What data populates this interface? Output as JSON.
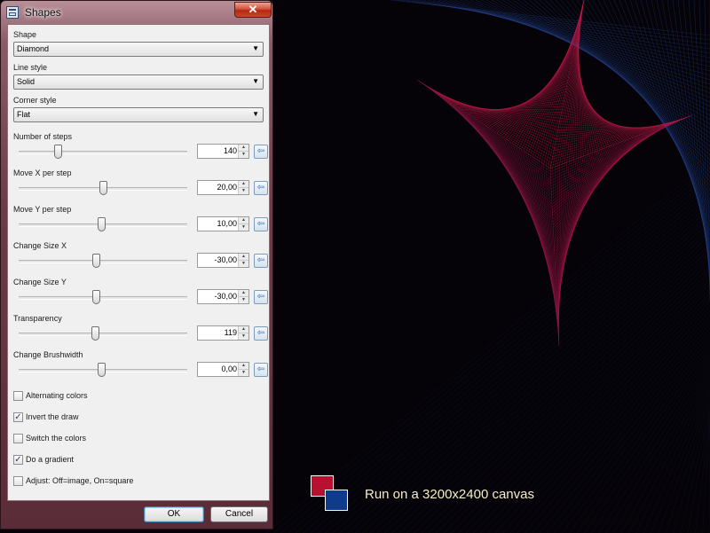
{
  "window": {
    "title": "Shapes",
    "close_label": "✕",
    "ok_label": "OK",
    "cancel_label": "Cancel"
  },
  "dropdowns": [
    {
      "label": "Shape",
      "value": "Diamond"
    },
    {
      "label": "Line style",
      "value": "Solid"
    },
    {
      "label": "Corner style",
      "value": "Flat"
    }
  ],
  "sliders": [
    {
      "label": "Number of steps",
      "value": "140",
      "position": 0.23
    },
    {
      "label": "Move X per step",
      "value": "20,00",
      "position": 0.5
    },
    {
      "label": "Move Y per step",
      "value": "10,00",
      "position": 0.49
    },
    {
      "label": "Change Size X",
      "value": "-30,00",
      "position": 0.46
    },
    {
      "label": "Change Size Y",
      "value": "-30,00",
      "position": 0.46
    },
    {
      "label": "Transparency",
      "value": "119",
      "position": 0.45
    },
    {
      "label": "Change Brushwidth",
      "value": "0,00",
      "position": 0.49
    }
  ],
  "checkboxes": [
    {
      "label": "Alternating colors",
      "checked": false
    },
    {
      "label": "Invert the draw",
      "checked": true
    },
    {
      "label": "Switch the colors",
      "checked": false
    },
    {
      "label": "Do a gradient",
      "checked": true
    },
    {
      "label": "Adjust: Off=image, On=square",
      "checked": false
    }
  ],
  "icons": {
    "app": "shapes-app-icon",
    "reset": "arrow-left-icon",
    "spin_up": "▲",
    "spin_down": "▼",
    "dropdown_arrow": "▼",
    "check_mark": "✓"
  },
  "legend": {
    "primary_color": "#b7112f",
    "secondary_color": "#0e3b8b",
    "caption": "Run on a 3200x2400 canvas"
  },
  "canvas": {
    "background_color": "#050307",
    "primary_line_color": "#b7112f",
    "secondary_line_color": "#0e3b8b"
  }
}
